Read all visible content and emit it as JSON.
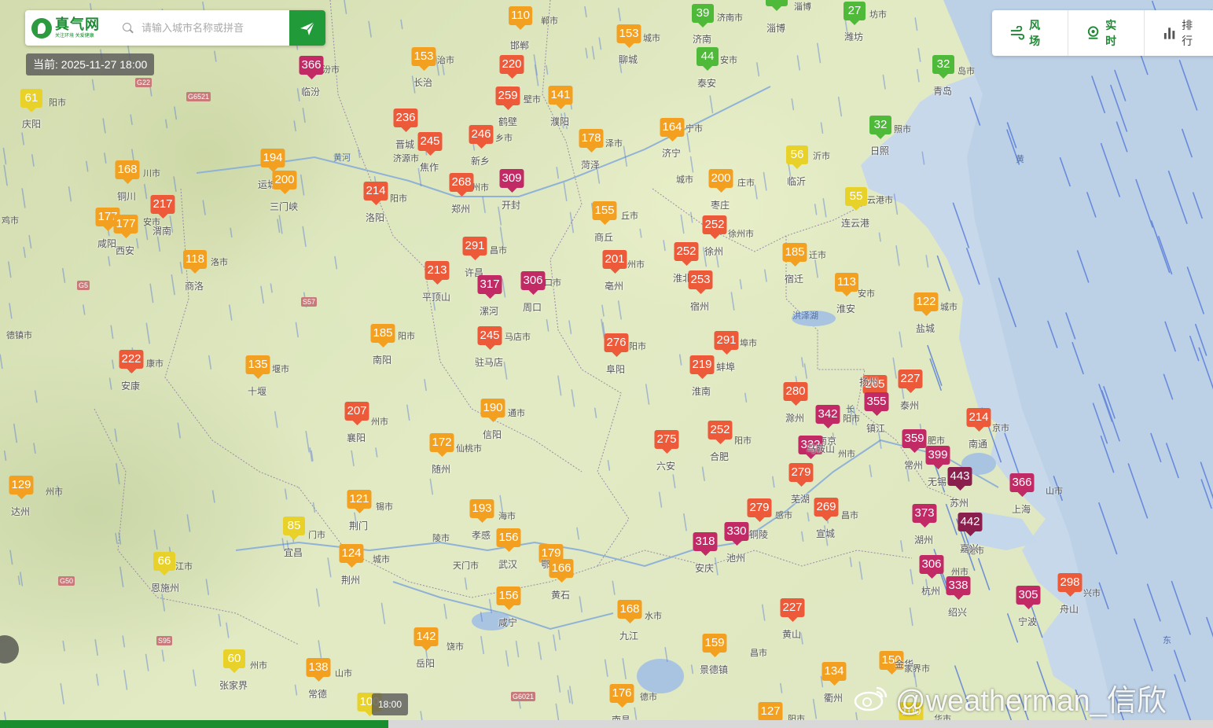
{
  "search": {
    "logo_name": "真气网",
    "logo_slogan": "关注环境 关爱健康",
    "placeholder": "请输入城市名称或拼音"
  },
  "time_label": "当前: 2025-11-27 18:00",
  "toolbar": {
    "items": [
      {
        "label": "风场",
        "icon": "wind-icon"
      },
      {
        "label": "实时",
        "icon": "location-icon"
      },
      {
        "label": "排行",
        "icon": "bar-chart-icon"
      }
    ]
  },
  "timeline": {
    "handle_label": "18:00",
    "progress": 0.32
  },
  "watermark": "@weatherman_信欣",
  "colors": {
    "good": "#4fba3a",
    "moderate": "#e8d22a",
    "usg": "#f3a020",
    "unhealthy": "#ec5a3a",
    "very_unhealthy": "#c22a66",
    "hazardous": "#8a1f4e",
    "brand": "#219a3a"
  },
  "stations": [
    {
      "v": "366",
      "c": "临汾"
    },
    {
      "v": "61",
      "c": "庆阳"
    },
    {
      "v": "153",
      "c": "长治"
    },
    {
      "v": "110",
      "c": "邯郸"
    },
    {
      "v": "153",
      "c": "聊城"
    },
    {
      "v": "39",
      "c": "济南"
    },
    {
      "v": "31",
      "c": "淄博"
    },
    {
      "v": "27",
      "c": "潍坊"
    },
    {
      "v": "220",
      "c": "安阳"
    },
    {
      "v": "44",
      "c": "泰安"
    },
    {
      "v": "32",
      "c": "青岛"
    },
    {
      "v": "259",
      "c": "鹤壁"
    },
    {
      "v": "141",
      "c": "濮阳"
    },
    {
      "v": "236",
      "c": "晋城"
    },
    {
      "v": "164",
      "c": "济宁"
    },
    {
      "v": "32",
      "c": "日照"
    },
    {
      "v": "246",
      "c": "新乡"
    },
    {
      "v": "245",
      "c": "焦作"
    },
    {
      "v": "178",
      "c": "菏泽"
    },
    {
      "v": "194",
      "c": "运城"
    },
    {
      "v": "168",
      "c": "铜川"
    },
    {
      "v": "56",
      "c": "临沂"
    },
    {
      "v": "200",
      "c": "三门峡"
    },
    {
      "v": "200",
      "c": "枣庄"
    },
    {
      "v": "214",
      "c": "洛阳"
    },
    {
      "v": "268",
      "c": "郑州"
    },
    {
      "v": "309",
      "c": "开封"
    },
    {
      "v": "55",
      "c": "连云港"
    },
    {
      "v": "217",
      "c": "渭南"
    },
    {
      "v": "177",
      "c": "咸阳"
    },
    {
      "v": "177",
      "c": "西安"
    },
    {
      "v": "155",
      "c": "商丘"
    },
    {
      "v": "252",
      "c": "徐州"
    },
    {
      "v": "118",
      "c": "商洛"
    },
    {
      "v": "291",
      "c": "许昌"
    },
    {
      "v": "201",
      "c": "亳州"
    },
    {
      "v": "252",
      "c": "淮北"
    },
    {
      "v": "185",
      "c": "宿迁"
    },
    {
      "v": "213",
      "c": "平顶山"
    },
    {
      "v": "317",
      "c": "漯河"
    },
    {
      "v": "306",
      "c": "周口"
    },
    {
      "v": "253",
      "c": "宿州"
    },
    {
      "v": "113",
      "c": "淮安"
    },
    {
      "v": "122",
      "c": "盐城"
    },
    {
      "v": "185",
      "c": "南阳"
    },
    {
      "v": "245",
      "c": "驻马店"
    },
    {
      "v": "276",
      "c": "阜阳"
    },
    {
      "v": "291",
      "c": "蚌埠"
    },
    {
      "v": "222",
      "c": "安康"
    },
    {
      "v": "135",
      "c": "十堰"
    },
    {
      "v": "219",
      "c": "淮南"
    },
    {
      "v": "265",
      "c": "扬州"
    },
    {
      "v": "227",
      "c": "泰州"
    },
    {
      "v": "280",
      "c": "滁州"
    },
    {
      "v": "355",
      "c": "镇江"
    },
    {
      "v": "207",
      "c": "襄阳"
    },
    {
      "v": "190",
      "c": "信阳"
    },
    {
      "v": "342",
      "c": "南京"
    },
    {
      "v": "214",
      "c": "南通"
    },
    {
      "v": "172",
      "c": "随州"
    },
    {
      "v": "275",
      "c": "六安"
    },
    {
      "v": "252",
      "c": "合肥"
    },
    {
      "v": "332",
      "c": "马鞍山"
    },
    {
      "v": "359",
      "c": "常州"
    },
    {
      "v": "399",
      "c": "无锡"
    },
    {
      "v": "129",
      "c": "达州"
    },
    {
      "v": "279",
      "c": "芜湖"
    },
    {
      "v": "443",
      "c": "苏州"
    },
    {
      "v": "366",
      "c": "上海"
    },
    {
      "v": "121",
      "c": "荆门"
    },
    {
      "v": "193",
      "c": "孝感"
    },
    {
      "v": "85",
      "c": "宜昌"
    },
    {
      "v": "279",
      "c": "铜陵"
    },
    {
      "v": "269",
      "c": "宣城"
    },
    {
      "v": "373",
      "c": "湖州"
    },
    {
      "v": "442",
      "c": "嘉兴"
    },
    {
      "v": "156",
      "c": "武汉"
    },
    {
      "v": "66",
      "c": "恩施州"
    },
    {
      "v": "124",
      "c": "荆州"
    },
    {
      "v": "179",
      "c": "鄂州"
    },
    {
      "v": "166",
      "c": "黄石"
    },
    {
      "v": "318",
      "c": "安庆"
    },
    {
      "v": "330",
      "c": "池州"
    },
    {
      "v": "306",
      "c": "杭州"
    },
    {
      "v": "338",
      "c": "绍兴"
    },
    {
      "v": "298",
      "c": "舟山"
    },
    {
      "v": "305",
      "c": "宁波"
    },
    {
      "v": "156",
      "c": "咸宁"
    },
    {
      "v": "168",
      "c": "九江"
    },
    {
      "v": "227",
      "c": "黄山"
    },
    {
      "v": "142",
      "c": "岳阳"
    },
    {
      "v": "159",
      "c": "景德镇"
    },
    {
      "v": "60",
      "c": "张家界"
    },
    {
      "v": "138",
      "c": "常德"
    },
    {
      "v": "150",
      "c": "金华"
    },
    {
      "v": "134",
      "c": "衢州"
    },
    {
      "v": "176",
      "c": "南昌"
    },
    {
      "v": "100",
      "c": ""
    },
    {
      "v": "127",
      "c": ""
    },
    {
      "v": "100",
      "c": ""
    }
  ],
  "place_labels": [
    "汾市",
    "阳市",
    "治市",
    "郸市",
    "城市",
    "济南市",
    "淄博",
    "坊市",
    "安市",
    "岛市",
    "壁市",
    "宁市",
    "照市",
    "乡市",
    "泽市",
    "城市",
    "济源市",
    "庄市",
    "沂市",
    "州市",
    "川市",
    "鸡市",
    "安市",
    "云港市",
    "阳市",
    "丘市",
    "徐州市",
    "洛市",
    "昌市",
    "州市",
    "口市",
    "迁市",
    "安市",
    "城市",
    "阳市",
    "马店市",
    "阳市",
    "埠市",
    "堰市",
    "康市",
    "州市",
    "州市",
    "阳市",
    "京市",
    "通市",
    "阳市",
    "州市",
    "肥市",
    "山市",
    "锡市",
    "海市",
    "门市",
    "感市",
    "昌市",
    "陵市",
    "城市",
    "天门市",
    "潜江市",
    "仙桃市",
    "施市",
    "州市",
    "兴市",
    "州市",
    "山市",
    "家界市",
    "德市",
    "阳市",
    "华市",
    "昌市",
    "饶市",
    "德镇市",
    "水市"
  ],
  "water_labels": [
    "黄河",
    "洪泽湖",
    "长",
    "黄",
    "东"
  ]
}
